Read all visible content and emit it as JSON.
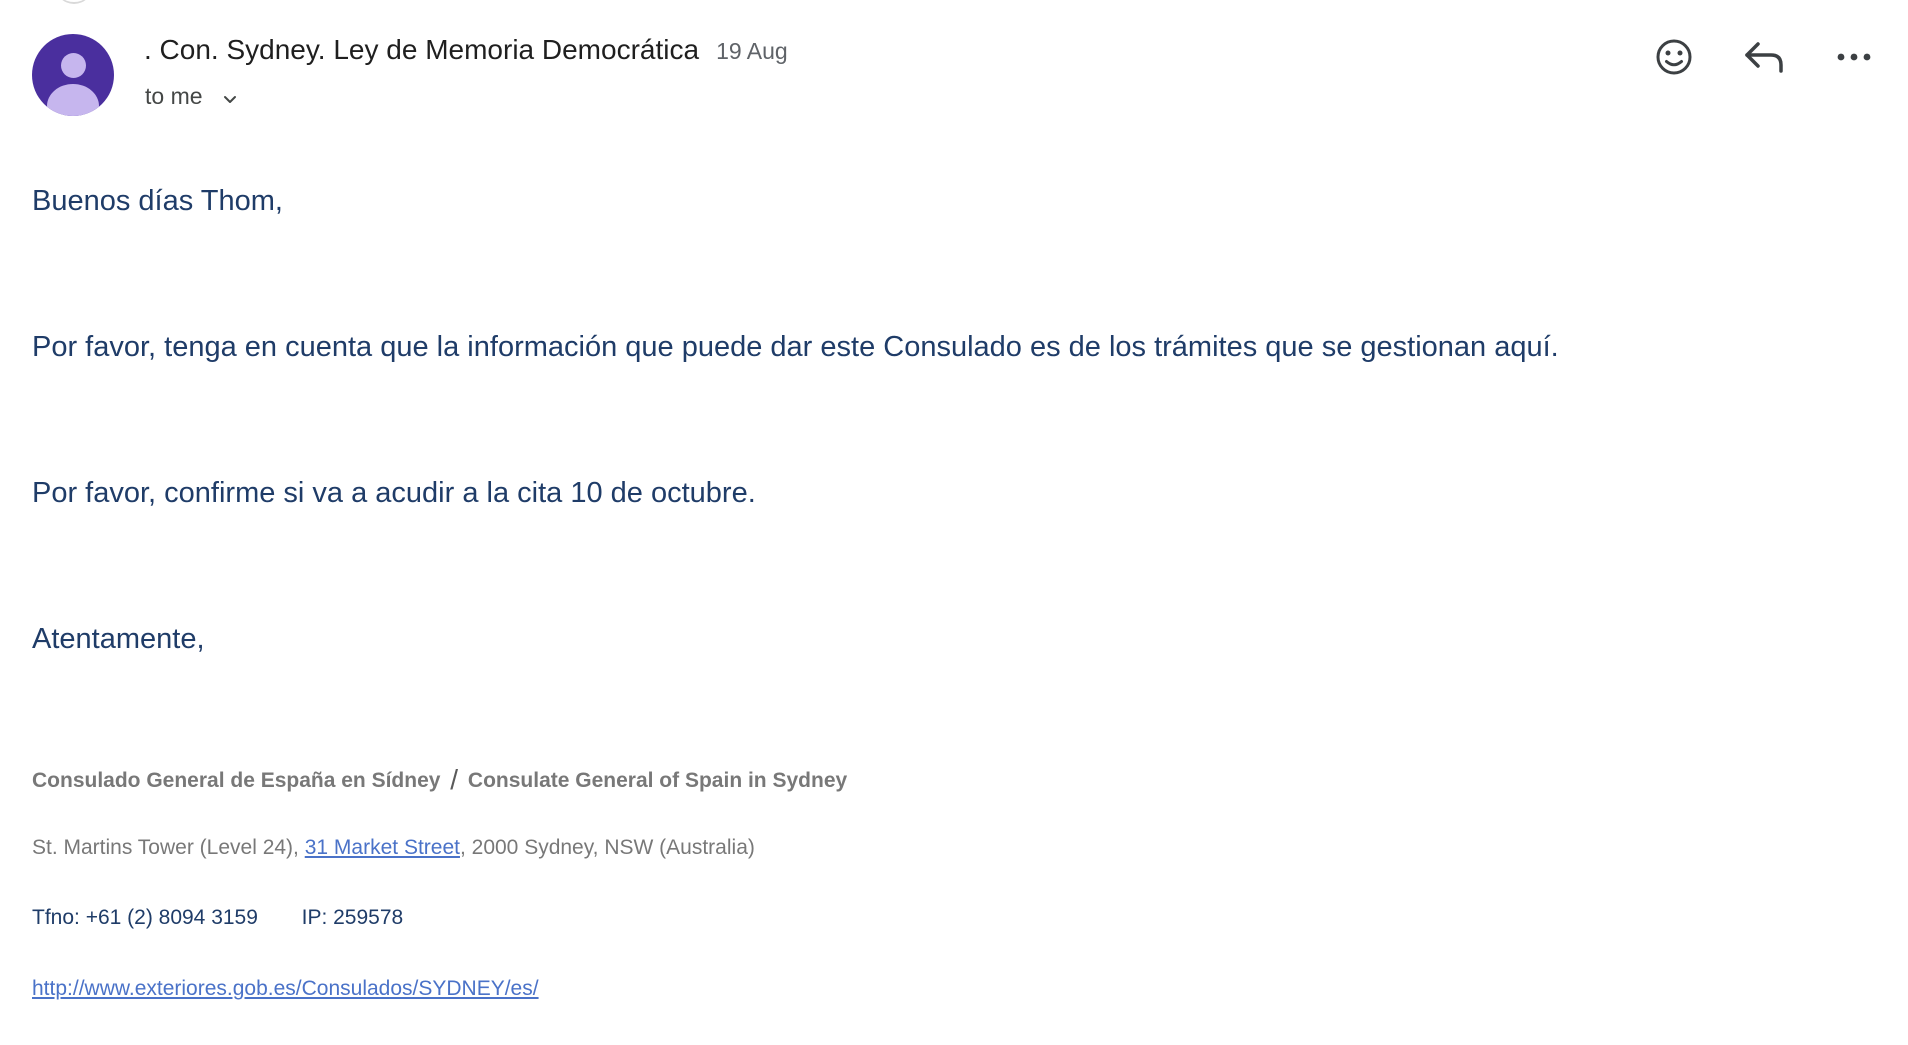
{
  "header": {
    "sender": ". Con. Sydney. Ley de Memoria Democrática",
    "date": "19 Aug",
    "recipient": "to me",
    "icons": {
      "avatar": "avatar-person-icon",
      "emoji": "emoji-reaction-icon",
      "reply": "reply-icon",
      "more": "more-options-icon",
      "expand": "chevron-down-icon"
    }
  },
  "body": {
    "greeting": "Buenos días Thom,",
    "paragraph_1": "Por favor, tenga en cuenta que la información que puede dar este Consulado es de los trámites que se gestionan aquí.",
    "paragraph_2": "Por favor, confirme si va a acudir a la cita 10 de octubre.",
    "closing": "Atentamente,"
  },
  "signature": {
    "title_es": "Consulado General de España en Sídney",
    "separator": "/",
    "title_en": "Consulate General of Spain in Sydney",
    "address_prefix": "St. Martins Tower (Level 24),",
    "address_link": "31 Market Street",
    "address_suffix": ", 2000 Sydney, NSW (Australia)",
    "phone": "Tfno: +61 (2) 8094 3159",
    "ip": "IP: 259578",
    "url": "http://www.exteriores.gob.es/Consulados/SYDNEY/es/"
  },
  "colors": {
    "avatar_bg": "#4a2f9e",
    "avatar_fg": "#c6b6ee",
    "body_text": "#1f3c68",
    "signature_gray": "#787878",
    "link": "#4a72c8"
  }
}
